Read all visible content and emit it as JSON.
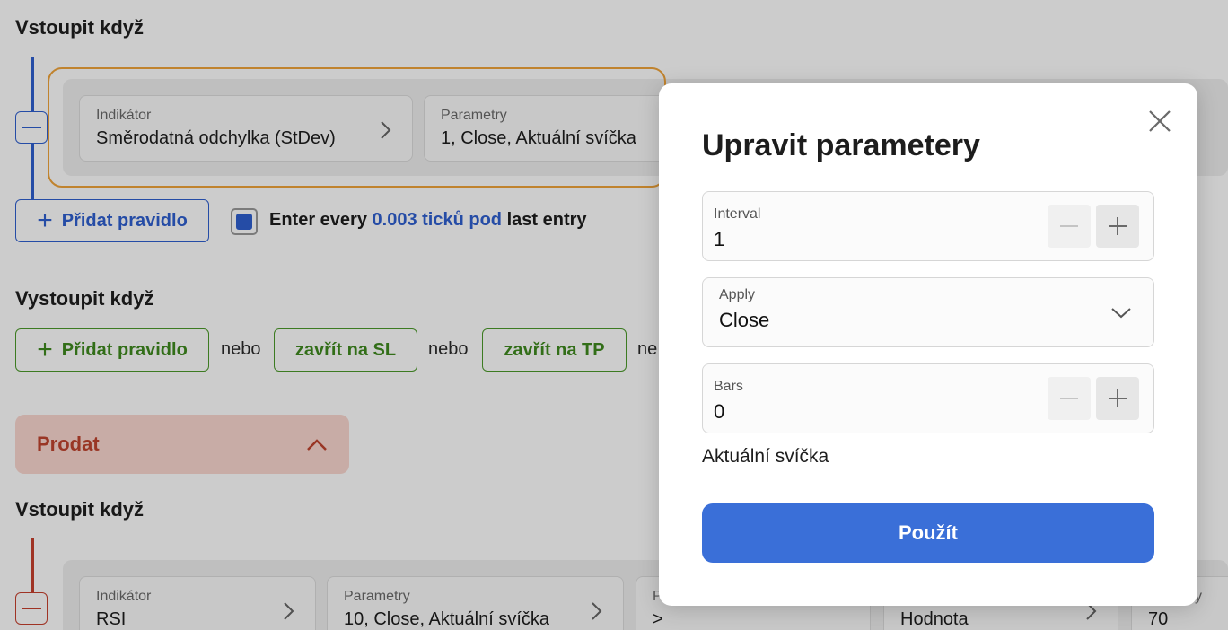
{
  "buy": {
    "entry_title": "Vstoupit když",
    "rule": {
      "indicator_label": "Indikátor",
      "indicator_value": "Směrodatná odchylka (StDev)",
      "params_label": "Parametry",
      "params_value": "1, Close, Aktuální svíčka"
    },
    "add_rule_label": "Přidat pravidlo",
    "enter_every": {
      "prefix": "Enter every",
      "link": "0.003 ticků pod",
      "suffix": "last entry",
      "checked": true
    },
    "exit_title": "Vystoupit když",
    "exit_add_rule_label": "Přidat pravidlo",
    "or_word": "nebo",
    "close_sl_label": "zavřít na SL",
    "close_tp_label": "zavřít na TP",
    "or_word_cut": "ne"
  },
  "sell": {
    "title": "Prodat",
    "entry_title": "Vstoupit když",
    "rule": {
      "indicator_label": "Indikátor",
      "indicator_value": "RSI",
      "params_label": "Parametry",
      "params_value": "10, Close, Aktuální svíčka",
      "condition_label": "P",
      "condition_value": ">",
      "compare_value": "Hodnota",
      "last_label": "etry",
      "last_value": "70"
    }
  },
  "modal": {
    "title": "Upravit parametery",
    "interval_label": "Interval",
    "interval_value": "1",
    "apply_label": "Apply",
    "apply_value": "Close",
    "bars_label": "Bars",
    "bars_value": "0",
    "note": "Aktuální svíčka",
    "submit_label": "Použít"
  },
  "colors": {
    "accent_blue": "#3a6fd8",
    "highlight_orange": "#f0a43a",
    "buy_green": "#3f8a1f",
    "sell_red": "#c0442f"
  },
  "icons": [
    "minus-icon",
    "plus-icon",
    "chevron-right-icon",
    "chevron-down-icon",
    "chevron-up-icon",
    "close-icon"
  ]
}
